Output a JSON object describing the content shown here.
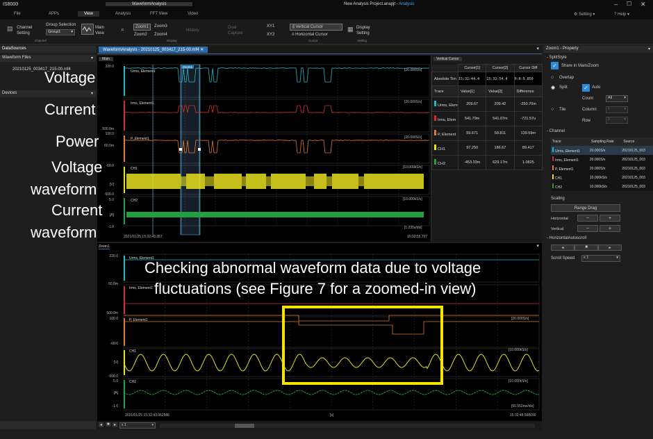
{
  "app": {
    "name": "IS8000",
    "window_title": "New Analysis Project.anapjt",
    "window_subtitle": "Analysis",
    "context_tab": "WaveformAnalysis"
  },
  "menu": {
    "tabs": [
      "File",
      "APPs",
      "View",
      "Analysis",
      "FFT View",
      "Video"
    ],
    "right": [
      "Setting",
      "Help"
    ]
  },
  "ribbon": {
    "channel_setting": "Channel Setting",
    "group_selection": "Group Selection",
    "group_value": "Group1",
    "group_channel": "Channel",
    "main_view": "Main View",
    "zoom1": "Zoom1",
    "zoom2": "Zoom2",
    "zoom3": "Zoom3",
    "zoom4": "Zoom4",
    "history": "History",
    "dual_capture": "Dual Capture",
    "xy1": "XY1",
    "xy2": "XY2",
    "group_display": "Display",
    "vertical_cursor": "Vertical Cursor",
    "horizontal_cursor": "Horizontal Cursor",
    "group_cursor": "Cursor",
    "display_setting": "Display Setting",
    "group_setting": "Setting"
  },
  "left": {
    "datasources": "DataSources",
    "waveform_files": "Waveform Files",
    "file": "20210125_003417_215-00.mf4",
    "devices": "Devices"
  },
  "doc_tab": "WaveformAnalysis - 20210125_003417_215-00.mf4",
  "main_tab": "Main",
  "main": {
    "traces": [
      {
        "name": "Urms, Element1",
        "top": "220.0",
        "bottom": "",
        "rate": "[20.000S/s]"
      },
      {
        "name": "Irms, Element1",
        "top": "60.0m",
        "bottom": "500.0m",
        "rate": "[20.000S/s]"
      },
      {
        "name": "P, Element1",
        "top": "100.0",
        "bottom": "-60.0",
        "rate": "[20.000S/s]"
      },
      {
        "name": "CH1",
        "top": "",
        "bottom": "-500.0",
        "unit": "[V]",
        "rate": "[10.000kS/s]"
      },
      {
        "name": "CH2",
        "top": "5.0",
        "bottom": "-1.0",
        "unit": "[A]",
        "rate": "[10.000kS/s]"
      }
    ],
    "zoom_marker": "Zoom1",
    "start_time": "2021/01/25 15:32:43.357",
    "end_time": "15:32:55.707",
    "div": "[1.235s/div]"
  },
  "cursor": {
    "title": "Vertical Cursor",
    "cols": [
      "Cursor[1]",
      "Cursor[2]",
      "Cursor Diff"
    ],
    "abs_label": "Absolute Tim",
    "abs": [
      "15:32:44.4",
      "15:32:54.4",
      "0:0:9.850"
    ],
    "hdr": [
      "Trace",
      "Value[1]",
      "Value[2]",
      "Difference"
    ],
    "rows": [
      {
        "trace": "Urms, Elem",
        "v1": "209.67",
        "v2": "209.42",
        "diff": "-250.70m",
        "color": "#22b8c8"
      },
      {
        "trace": "Irms, Elem",
        "v1": "541.79m",
        "v2": "541.07m",
        "diff": "-721.57u",
        "color": "#d03030"
      },
      {
        "trace": "P, Element",
        "v1": "59.671",
        "v2": "59.811",
        "diff": "139.59m",
        "color": "#e07a30"
      },
      {
        "trace": "CH1",
        "v1": "97.250",
        "v2": "186.67",
        "diff": "89.417",
        "color": "#e8e020"
      },
      {
        "trace": "CH2",
        "v1": "-453.33m",
        "v2": "629.17m",
        "diff": "1.0825",
        "color": "#20a040"
      }
    ]
  },
  "zoom": {
    "tab": "Zoom1",
    "traces": [
      {
        "name": "Urms, Element1",
        "top": "220.0",
        "bottom": "",
        "rate": ""
      },
      {
        "name": "Irms, Element1",
        "top": "60.0m",
        "bottom": "500.0m",
        "rate": ""
      },
      {
        "name": "P, Element1",
        "top": "100.0",
        "bottom": "-60.0",
        "rate": "[20.000S/s]"
      },
      {
        "name": "CH1",
        "top": "",
        "bottom": "-500.0",
        "unit": "[V]",
        "rate": "[10.000kS/s]"
      },
      {
        "name": "CH2",
        "top": "5.0",
        "bottom": "-1.0",
        "unit": "[A]",
        "rate": "[10.000kS/s]"
      }
    ],
    "start_time": "2021/01/25 15:32:43.062586",
    "end_time": "15:32:48.568090",
    "mid": "[s]",
    "div": "[65.552ms/div]",
    "zoom_value": "x 1"
  },
  "property": {
    "title": "Zoom1 - Property",
    "split_style": "SplitStyle",
    "share": "Share in Main/Zoom",
    "overlap": "Overlap",
    "split": "Split",
    "auto": "Auto",
    "count": "Count",
    "count_value": "All",
    "tile": "Tile",
    "column": "Column",
    "column_value": "1",
    "row": "Row",
    "row_value": "2",
    "channel": "Channel",
    "ch_hdr": [
      "Trace",
      "Sampling Rate",
      "Source"
    ],
    "ch_rows": [
      {
        "trace": "Urms, Element1",
        "rate": "20.000S/s",
        "src": "20210125_003",
        "color": "#22b8c8"
      },
      {
        "trace": "Irms, Element1",
        "rate": "20.000S/s",
        "src": "20210125_003",
        "color": "#d03030"
      },
      {
        "trace": "P, Element1",
        "rate": "20.000S/s",
        "src": "20210125_003",
        "color": "#e07a30"
      },
      {
        "trace": "CH1",
        "rate": "10.000kS/s",
        "src": "20210125_003",
        "color": "#e8e020"
      },
      {
        "trace": "CH2",
        "rate": "10.000kS/s",
        "src": "20210125_003",
        "color": "#20a040"
      }
    ],
    "scaling": "Scaling",
    "range_drag": "Range Drag",
    "horizontal": "Horizontal",
    "vertical": "Vertical",
    "minus": "−",
    "plus": "+",
    "hauto": "HorizontalAutoscroll",
    "scroll_speed": "Scroll Speed",
    "scroll_value": "x 1"
  },
  "annotations": {
    "voltage": "Voltage",
    "current": "Current",
    "power": "Power",
    "voltage_wf_1": "Voltage",
    "voltage_wf_2": "waveform",
    "current_wf_1": "Current",
    "current_wf_2": "waveform",
    "note_1": "Checking abnormal waveform data due to voltage",
    "note_2": "fluctuations (see Figure 7 for a zoomed-in view)"
  },
  "colors": {
    "voltage": "#22b8c8",
    "current": "#d03030",
    "power": "#e07a30",
    "ch1": "#e8e020",
    "ch2": "#20a040",
    "highlight": "#f5e400"
  }
}
